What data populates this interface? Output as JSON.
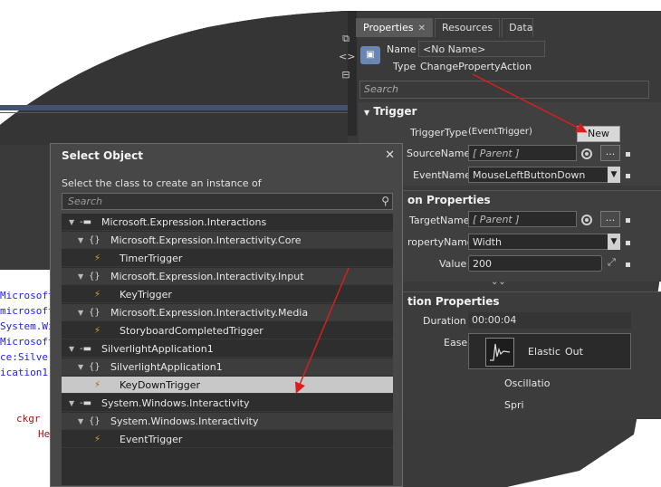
{
  "code_lines": [
    {
      "text": "Microsoft",
      "color": "blue"
    },
    {
      "text": "microsoft",
      "color": "blue"
    },
    {
      "text": "System.Wi",
      "color": "blue"
    },
    {
      "text": "Microsoft",
      "color": "blue"
    },
    {
      "text": "ce:Silve",
      "color": "blue"
    },
    {
      "text": "ication1",
      "color": "blue"
    },
    {
      "text": "",
      "color": "blue"
    },
    {
      "text": "",
      "color": "blue"
    },
    {
      "text": "ckgr",
      "color": "red"
    },
    {
      "text": "He",
      "color": "red"
    }
  ],
  "properties_panel": {
    "tabs": [
      {
        "label": "Properties",
        "active": true,
        "closable": true
      },
      {
        "label": "Resources",
        "active": false
      },
      {
        "label": "Data",
        "active": false
      }
    ],
    "sidebar_icons": [
      "pin-icon",
      "code-icon",
      "layout-icon"
    ],
    "name_label": "Name",
    "name_value": "<No Name>",
    "type_label": "Type",
    "type_value": "ChangePropertyAction",
    "search_placeholder": "Search",
    "trigger_section": {
      "title": "Trigger",
      "trigger_type_label": "TriggerType",
      "trigger_type_value": "(EventTrigger)",
      "new_button": "New",
      "source_name_label": "SourceName",
      "source_name_value": "[ Parent ]",
      "event_name_label": "EventName",
      "event_name_value": "MouseLeftButtonDown"
    },
    "common_section": {
      "title": "on Properties",
      "target_name_label": "TargetName",
      "target_name_value": "[ Parent ]",
      "property_name_label": "ropertyName",
      "property_name_value": "Width",
      "value_label": "Value",
      "value_value": "200"
    },
    "animation_section": {
      "title": "tion Properties",
      "duration_label": "Duration",
      "duration_value": "00:00:04",
      "ease_label": "Ease",
      "ease_value": "Elastic",
      "ease_mode": "Out",
      "oscillation_label": "Oscillatio",
      "springiness_label": "Spri"
    }
  },
  "dialog": {
    "title": "Select Object",
    "subtitle": "Select the class to create an instance of",
    "search_placeholder": "Search",
    "tree": [
      {
        "label": "Microsoft.Expression.Interactions",
        "kind": "assembly",
        "level": 0
      },
      {
        "label": "Microsoft.Expression.Interactivity.Core",
        "kind": "namespace",
        "level": 1
      },
      {
        "label": "TimerTrigger",
        "kind": "class",
        "level": 2
      },
      {
        "label": "Microsoft.Expression.Interactivity.Input",
        "kind": "namespace",
        "level": 1
      },
      {
        "label": "KeyTrigger",
        "kind": "class",
        "level": 2
      },
      {
        "label": "Microsoft.Expression.Interactivity.Media",
        "kind": "namespace",
        "level": 1
      },
      {
        "label": "StoryboardCompletedTrigger",
        "kind": "class",
        "level": 2
      },
      {
        "label": "SilverlightApplication1",
        "kind": "assembly",
        "level": 0
      },
      {
        "label": "SilverlightApplication1",
        "kind": "namespace",
        "level": 1
      },
      {
        "label": "KeyDownTrigger",
        "kind": "class",
        "level": 2,
        "selected": true
      },
      {
        "label": "System.Windows.Interactivity",
        "kind": "assembly",
        "level": 0
      },
      {
        "label": "System.Windows.Interactivity",
        "kind": "namespace",
        "level": 1
      },
      {
        "label": "EventTrigger",
        "kind": "class",
        "level": 2
      }
    ],
    "glyphs": {
      "toggle": "▼",
      "assembly": "-▬",
      "namespace": "{}",
      "class": "⚡"
    }
  },
  "colors": {
    "arrow": "#d81e1e",
    "panel_dark": "#3b3b3b",
    "panel_mid": "#474747",
    "selection": "#c8c8c8"
  }
}
